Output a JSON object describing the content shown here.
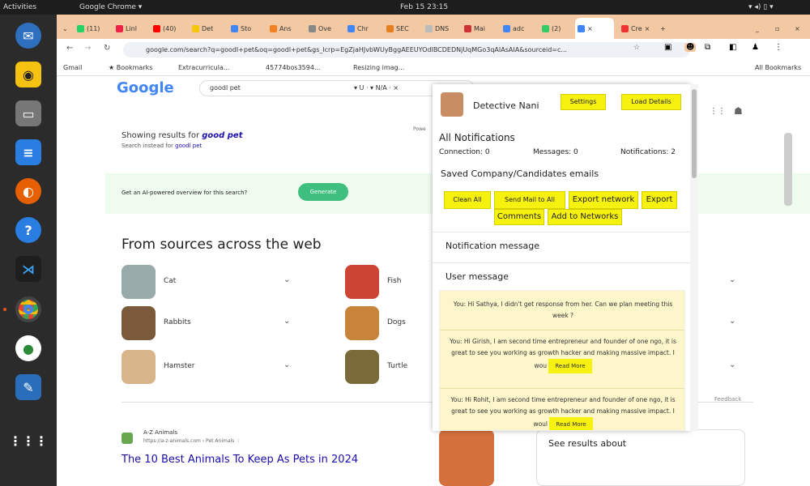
{
  "system": {
    "activities": "Activities",
    "app_menu": "Google Chrome ▾",
    "clock": "Feb 15 23:15"
  },
  "tabs": [
    {
      "label": "(11)",
      "color": "#25d366"
    },
    {
      "label": "Linl",
      "color": "#e24"
    },
    {
      "label": "(40)",
      "color": "#ff0000"
    },
    {
      "label": "Det",
      "color": "#f6c60e"
    },
    {
      "label": "Sto",
      "color": "#4285f4"
    },
    {
      "label": "Ans",
      "color": "#f48024"
    },
    {
      "label": "Ove",
      "color": "#888"
    },
    {
      "label": "Chr",
      "color": "#4285f4"
    },
    {
      "label": "SEC",
      "color": "#e67e22"
    },
    {
      "label": "DNS",
      "color": "#bbb"
    },
    {
      "label": "Mai",
      "color": "#c33"
    },
    {
      "label": "adc",
      "color": "#4285f4"
    },
    {
      "label": "(2)",
      "color": "#3c6"
    },
    {
      "label": "",
      "color": "#4285f4"
    },
    {
      "label": "Cre",
      "color": "#e33"
    }
  ],
  "address": {
    "url": "google.com/search?q=goodl+pet&oq=goodl+pet&gs_lcrp=EgZjaHJvbWUyBggAEEUYOdIBCDEDNjUqMGo3qAIAsAIA&sourceid=c..."
  },
  "bookmarks": {
    "gmail": "Gmail",
    "bookmarks": "Bookmarks",
    "extracurricular": "Extracurricula...",
    "hash": "45774bos3594...",
    "resizing": "Resizing imag...",
    "all": "All Bookmarks"
  },
  "google": {
    "logo": "Google",
    "query": "goodl pet",
    "filters": "▾ U · ▾ N/A · ×",
    "powered": "Powe",
    "showing_prefix": "Showing results for ",
    "showing_query": "good pet",
    "instead_prefix": "Search instead for ",
    "instead_query": "goodl pet",
    "ai_prompt": "Get an AI-powered overview for this search?",
    "generate": "Generate",
    "sources_heading": "From sources across the web",
    "items": [
      {
        "label": "Cat",
        "color": "#9aa"
      },
      {
        "label": "Fish",
        "color": "#c43"
      },
      {
        "label": "Rabbits",
        "color": "#7a5a3a"
      },
      {
        "label": "Dogs",
        "color": "#c8843a"
      },
      {
        "label": "Hamster",
        "color": "#d8b48a"
      },
      {
        "label": "Turtle",
        "color": "#7a6a3a"
      }
    ],
    "chevron": "⌄",
    "feedback": "Feedback",
    "site_name": "A-Z Animals",
    "site_url": "https://a-z-animals.com › Pet Animals  ⋮",
    "result_title": "The 10 Best Animals To Keep As Pets in 2024",
    "see_results": "See results about"
  },
  "panel": {
    "user_name": "Detective Nani",
    "settings": "Settings",
    "load_details": "Load Details",
    "title": "All Notifications",
    "connection": "Connection: 0",
    "messages": "Messages: 0",
    "notifications": "Notifications: 2",
    "saved_heading": "Saved Company/Candidates emails",
    "clean_all": "Clean All",
    "send_mail": "Send Mail to All",
    "export_network": "Export network",
    "export_comments_a": "Export",
    "export_comments_b": "Comments",
    "add_networks": "Add to Networks",
    "notification_message": "Notification message",
    "user_message": "User message",
    "msg1": "You: Hi Sathya, I didn't get response from her. Can we plan meeting this week ?",
    "msg2": "You: Hi Girish, I am second time entrepreneur and founder of one ngo, it is great to see you working as growth hacker and making massive impact. I wou",
    "msg3": "You: Hi Rohit, I am second time entrepreneur and founder of one ngo, it is great to see you working as growth hacker and making massive impact. I woul",
    "read_more": "Read More"
  }
}
